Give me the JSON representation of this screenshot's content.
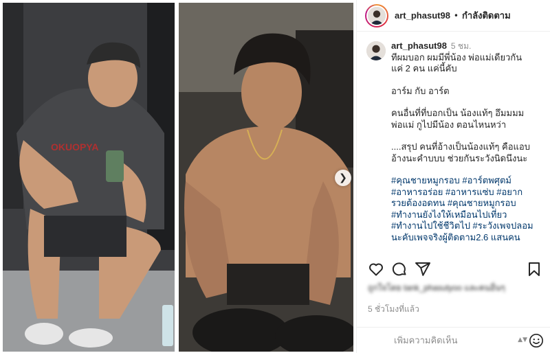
{
  "post": {
    "username": "art_phasut98",
    "follow_status": "กำลังติดตาม",
    "separator": "•",
    "caption_time": "5 ชม.",
    "caption_lines": [
      "ทีผมบอก ผมมีพี่น้อง พ่อแม่เดียวกัน",
      "แค่ 2 คน แค่นี้คับ",
      "",
      "อาร์ม กับ อาร์ต",
      "",
      "คนอื่นที่ที่บอกเป็น น้องแท้ๆ อึมมมม",
      "พ่อแม่ กูไปมีน้อง ตอนไหนหว่า",
      "",
      "....สรุป คนที่อ้างเป็นน้องแท้ๆ คือแอบ",
      "อ้างนะคำบบบ ช่วยกันระวังนิดนึงนะ",
      ""
    ],
    "hashtag_lines": [
      "#คุณชายหมูกรอบ #อาร์ตพศุตม์",
      "#อาหารอร่อย #อาหารแซ่บ #อยาก",
      "รวยต้องอดทน #คุณชายหมูกรอบ",
      "#ทำงานยังไงให้เหมือนไปเที่ยว",
      "#ทำงานไปใช้ชีวิตไป #ระวังเพจปลอม",
      "นะคับเพจจริงผู้ติดตาม2.6 แสนคน"
    ],
    "likes_text": "ถูกใจโดย tank_phasutyoo และคนอื่นๆ",
    "timestamp": "5 ชั่วโมงที่แล้ว",
    "comment_placeholder": "เพิ่มความคิดเห็น"
  },
  "icons": {
    "like": "heart-icon",
    "comment": "comment-icon",
    "share": "paper-plane-icon",
    "save": "bookmark-icon",
    "emoji": "smiley-icon",
    "next": "chevron-right-icon"
  },
  "colors": {
    "text": "#262626",
    "muted": "#8e8e8e",
    "hashtag": "#00376b",
    "border": "#efefef"
  }
}
